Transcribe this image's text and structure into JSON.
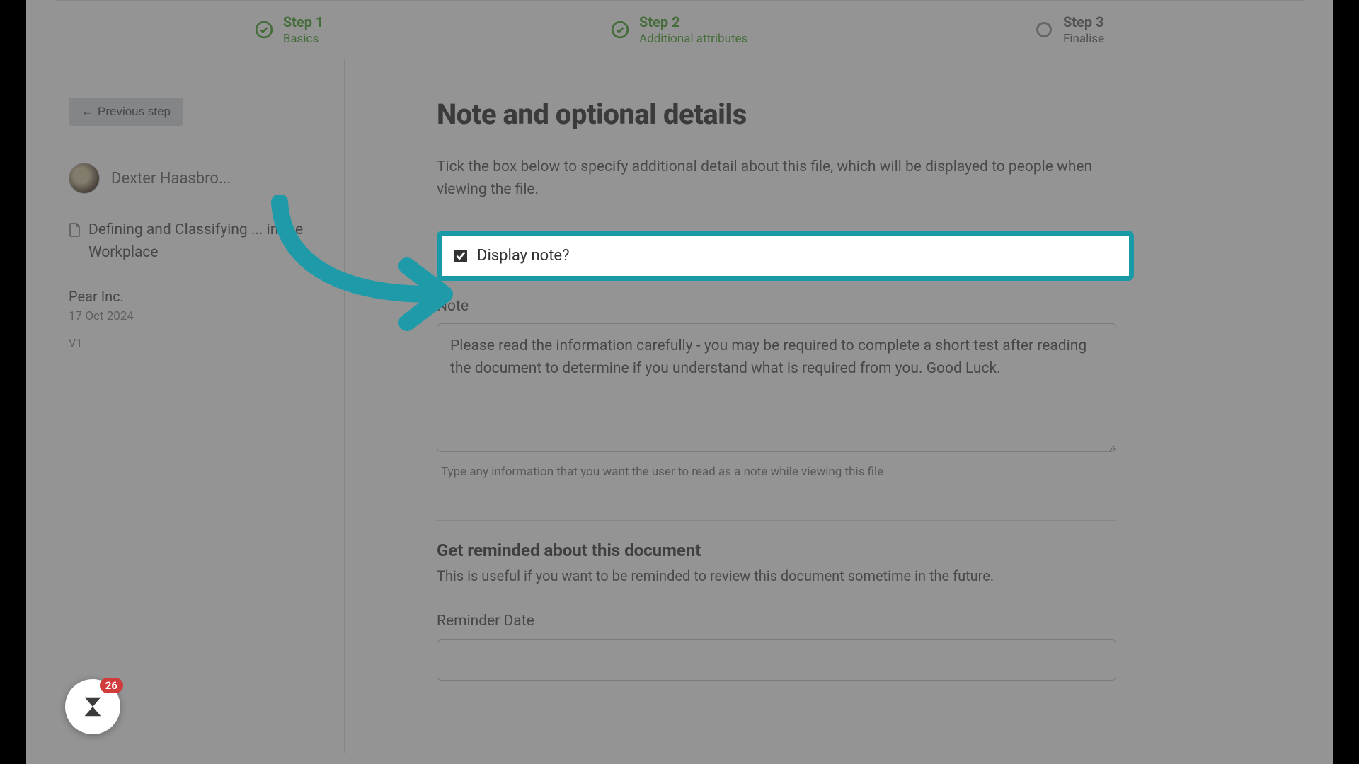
{
  "steps": [
    {
      "title": "Step 1",
      "sub": "Basics"
    },
    {
      "title": "Step 2",
      "sub": "Additional attributes"
    },
    {
      "title": "Step 3",
      "sub": "Finalise"
    }
  ],
  "sidebar": {
    "prev_label": "Previous step",
    "user_name": "Dexter Haasbro...",
    "doc_title": "Defining and Classifying ... in the Workplace",
    "company": "Pear Inc.",
    "date": "17 Oct 2024",
    "version": "V1"
  },
  "main": {
    "title": "Note and optional details",
    "intro": "Tick the box below to specify additional detail about this file, which will be displayed to people when viewing the file.",
    "display_note_label": "Display note?",
    "display_note_checked": true,
    "note_label": "Note",
    "note_value": "Please read the information carefully - you may be required to complete a short test after reading the document to determine if you understand what is required from you. Good Luck.",
    "note_helper": "Type any information that you want the user to read as a note while viewing this file",
    "reminder_title": "Get reminded about this document",
    "reminder_desc": "This is useful if you want to be reminded to review this document sometime in the future.",
    "reminder_label": "Reminder Date",
    "reminder_value": ""
  },
  "chat": {
    "badge": "26"
  },
  "colors": {
    "accent_teal": "#199aa6",
    "step_green": "#4fa736"
  }
}
